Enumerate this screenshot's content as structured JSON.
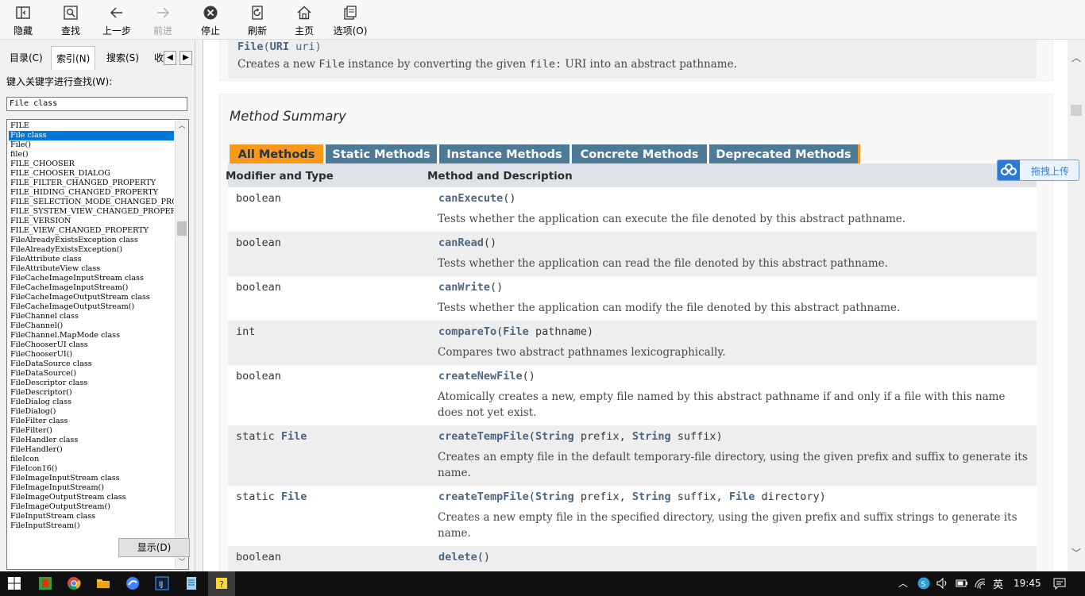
{
  "toolbar": {
    "hide": "隐藏",
    "find": "查找",
    "back": "上一步",
    "forward": "前进",
    "stop": "停止",
    "refresh": "刷新",
    "home": "主页",
    "options": "选项(O)"
  },
  "nav": {
    "tabs": [
      "目录(C)",
      "索引(N)",
      "搜索(S)",
      "收"
    ],
    "keyword_label": "键入关键字进行查找(W):",
    "keyword_value": "File class",
    "index_items": [
      "FILE",
      "File class",
      "File()",
      "file()",
      "FILE_CHOOSER",
      "FILE_CHOOSER_DIALOG",
      "FILE_FILTER_CHANGED_PROPERTY",
      "FILE_HIDING_CHANGED_PROPERTY",
      "FILE_SELECTION_MODE_CHANGED_PROPER",
      "FILE_SYSTEM_VIEW_CHANGED_PROPERTY",
      "FILE_VERSION",
      "FILE_VIEW_CHANGED_PROPERTY",
      "FileAlreadyExistsException class",
      "FileAlreadyExistsException()",
      "FileAttribute class",
      "FileAttributeView class",
      "FileCacheImageInputStream class",
      "FileCacheImageInputStream()",
      "FileCacheImageOutputStream class",
      "FileCacheImageOutputStream()",
      "FileChannel class",
      "FileChannel()",
      "FileChannel.MapMode class",
      "FileChooserUI class",
      "FileChooserUI()",
      "FileDataSource class",
      "FileDataSource()",
      "FileDescriptor class",
      "FileDescriptor()",
      "FileDialog class",
      "FileDialog()",
      "FileFilter class",
      "FileFilter()",
      "FileHandler class",
      "FileHandler()",
      "fileIcon",
      "FileIcon16()",
      "FileImageInputStream class",
      "FileImageInputStream()",
      "FileImageOutputStream class",
      "FileImageOutputStream()",
      "FileInputStream class",
      "FileInputStream()"
    ],
    "selected_index": 1,
    "show_button": "显示(D)"
  },
  "content": {
    "ctor_name": "File",
    "ctor_type": "URI",
    "ctor_param": " uri)",
    "ctor_desc_a": "Creates a new ",
    "ctor_desc_code1": "File",
    "ctor_desc_b": " instance by converting the given ",
    "ctor_desc_code2": "file:",
    "ctor_desc_c": " URI into an abstract pathname.",
    "method_summary_title": "Method Summary",
    "method_tabs": [
      "All Methods",
      "Static Methods",
      "Instance Methods",
      "Concrete Methods",
      "Deprecated Methods"
    ],
    "col_modifier": "Modifier and Type",
    "col_method": "Method and Description",
    "methods": [
      {
        "mod": "boolean",
        "name": "canExecute",
        "sig_parts": [
          "()"
        ],
        "desc": "Tests whether the application can execute the file denoted by this abstract pathname."
      },
      {
        "mod": "boolean",
        "name": "canRead",
        "sig_parts": [
          "()"
        ],
        "desc": "Tests whether the application can read the file denoted by this abstract pathname."
      },
      {
        "mod": "boolean",
        "name": "canWrite",
        "sig_parts": [
          "()"
        ],
        "desc": "Tests whether the application can modify the file denoted by this abstract pathname."
      },
      {
        "mod": "int",
        "name": "compareTo",
        "sig_parts": [
          "(",
          "File",
          " pathname)"
        ],
        "desc": "Compares two abstract pathnames lexicographically."
      },
      {
        "mod": "boolean",
        "name": "createNewFile",
        "sig_parts": [
          "()"
        ],
        "desc": "Atomically creates a new, empty file named by this abstract pathname if and only if a file with this name does not yet exist."
      },
      {
        "mod": "static ",
        "mod_ref": "File",
        "name": "createTempFile",
        "sig_parts": [
          "(",
          "String",
          " prefix, ",
          "String",
          " suffix)"
        ],
        "desc": "Creates an empty file in the default temporary-file directory, using the given prefix and suffix to generate its name."
      },
      {
        "mod": "static ",
        "mod_ref": "File",
        "name": "createTempFile",
        "sig_parts": [
          "(",
          "String",
          " prefix, ",
          "String",
          " suffix, ",
          "File",
          " directory)"
        ],
        "desc": "Creates a new empty file in the specified directory, using the given prefix and suffix strings to generate its name."
      },
      {
        "mod": "boolean",
        "name": "delete",
        "sig_parts": [
          "()"
        ],
        "desc": ""
      }
    ]
  },
  "upload_button": "拖拽上传",
  "tray": {
    "ime": "英",
    "time": "19:45"
  },
  "colors": {
    "tab_active": "#f8981d",
    "tab_inactive": "#4d7a97",
    "link": "#4a6782",
    "selection": "#0078d7"
  }
}
